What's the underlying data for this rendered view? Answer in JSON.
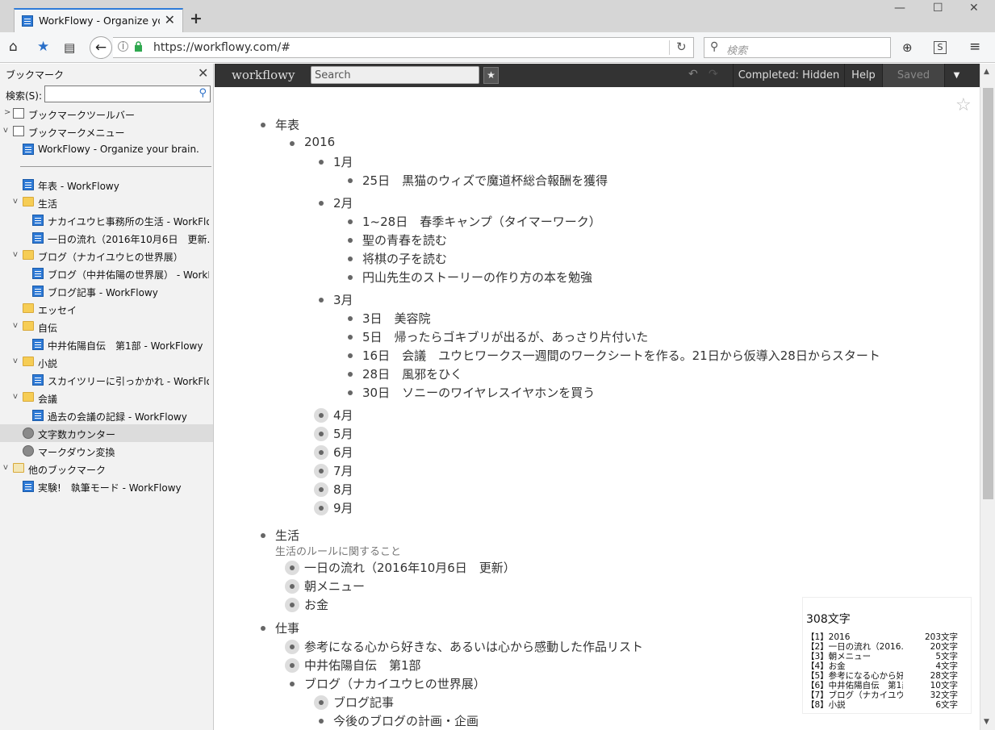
{
  "browser": {
    "tab_title": "WorkFlowy - Organize yo...",
    "url": "https://workflowy.com/#",
    "search_placeholder": "検索"
  },
  "sidebar": {
    "title": "ブックマーク",
    "search_label": "検索(S):",
    "items": [
      {
        "label": "ブックマークツールバー",
        "icon": "bookmark-toolbar-icon"
      },
      {
        "label": "ブックマークメニュー",
        "icon": "bookmark-menu-icon"
      },
      {
        "label": "WorkFlowy - Organize your brain.",
        "icon": "workflowy-favicon"
      },
      {
        "label": "年表 - WorkFlowy",
        "icon": "workflowy-favicon"
      },
      {
        "label": "生活",
        "icon": "folder-icon"
      },
      {
        "label": "ナカイユウヒ事務所の生活 - WorkFlo...",
        "icon": "workflowy-favicon"
      },
      {
        "label": "一日の流れ（2016年10月6日　更新...",
        "icon": "workflowy-favicon"
      },
      {
        "label": "ブログ（ナカイユウヒの世界展）",
        "icon": "folder-icon"
      },
      {
        "label": "ブログ（中井佑陽の世界展） - WorkFl...",
        "icon": "workflowy-favicon"
      },
      {
        "label": "ブログ記事 - WorkFlowy",
        "icon": "workflowy-favicon"
      },
      {
        "label": "エッセイ",
        "icon": "folder-icon"
      },
      {
        "label": "自伝",
        "icon": "folder-icon"
      },
      {
        "label": "中井佑陽自伝　第1部 - WorkFlowy",
        "icon": "workflowy-favicon"
      },
      {
        "label": "小説",
        "icon": "folder-icon"
      },
      {
        "label": "スカイツリーに引っかかれ - WorkFlowy",
        "icon": "workflowy-favicon"
      },
      {
        "label": "会議",
        "icon": "folder-icon"
      },
      {
        "label": "過去の会議の記録 - WorkFlowy",
        "icon": "workflowy-favicon"
      },
      {
        "label": "文字数カウンター",
        "icon": "globe-icon"
      },
      {
        "label": "マークダウン変換",
        "icon": "globe-icon"
      },
      {
        "label": "他のブックマーク",
        "icon": "other-bookmarks-icon"
      },
      {
        "label": "実験!　執筆モード - WorkFlowy",
        "icon": "workflowy-favicon"
      }
    ]
  },
  "workflowy": {
    "logo": "workflowy",
    "search_placeholder": "Search",
    "completed": "Completed: Hidden",
    "help": "Help",
    "saved": "Saved"
  },
  "outline": {
    "r0": "年表",
    "r1": "2016",
    "r2": "1月",
    "r3": "25日　黒猫のウィズで魔道杯総合報酬を獲得",
    "r4": "2月",
    "r5": "1~28日　春季キャンプ（タイマーワーク）",
    "r6": "聖の青春を読む",
    "r7": "将棋の子を読む",
    "r8": "円山先生のストーリーの作り方の本を勉強",
    "r9": "3月",
    "r10": "3日　美容院",
    "r11": "5日　帰ったらゴキブリが出るが、あっさり片付いた",
    "r12": "16日　会議　ユウヒワークス一週間のワークシートを作る。21日から仮導入28日からスタート",
    "r13": "28日　風邪をひく",
    "r14": "30日　ソニーのワイヤレスイヤホンを買う",
    "r15": "4月",
    "r16": "5月",
    "r17": "6月",
    "r18": "7月",
    "r19": "8月",
    "r20": "9月",
    "r21": "生活",
    "note21": "生活のルールに関すること",
    "r22": "一日の流れ（2016年10月6日　更新）",
    "r23": "朝メニュー",
    "r24": "お金",
    "r25": "仕事",
    "r26": "参考になる心から好きな、あるいは心から感動した作品リスト",
    "r27": "中井佑陽自伝　第1部",
    "r28": "ブログ（ナカイユウヒの世界展）",
    "r29": "ブログ記事",
    "r30": "今後のブログの計画・企画"
  },
  "counter": {
    "total": "308文字",
    "lines": [
      {
        "name": "【1】2016",
        "count": "203文字"
      },
      {
        "name": "【2】一日の流れ（2016…",
        "count": "20文字"
      },
      {
        "name": "【3】朝メニュー",
        "count": "5文字"
      },
      {
        "name": "【4】お金",
        "count": "4文字"
      },
      {
        "name": "【5】参考になる心から好き…",
        "count": "28文字"
      },
      {
        "name": "【6】中井佑陽自伝　第1部",
        "count": "10文字"
      },
      {
        "name": "【7】ブログ（ナカイユウヒ…",
        "count": "32文字"
      },
      {
        "name": "【8】小説",
        "count": "6文字"
      }
    ]
  }
}
